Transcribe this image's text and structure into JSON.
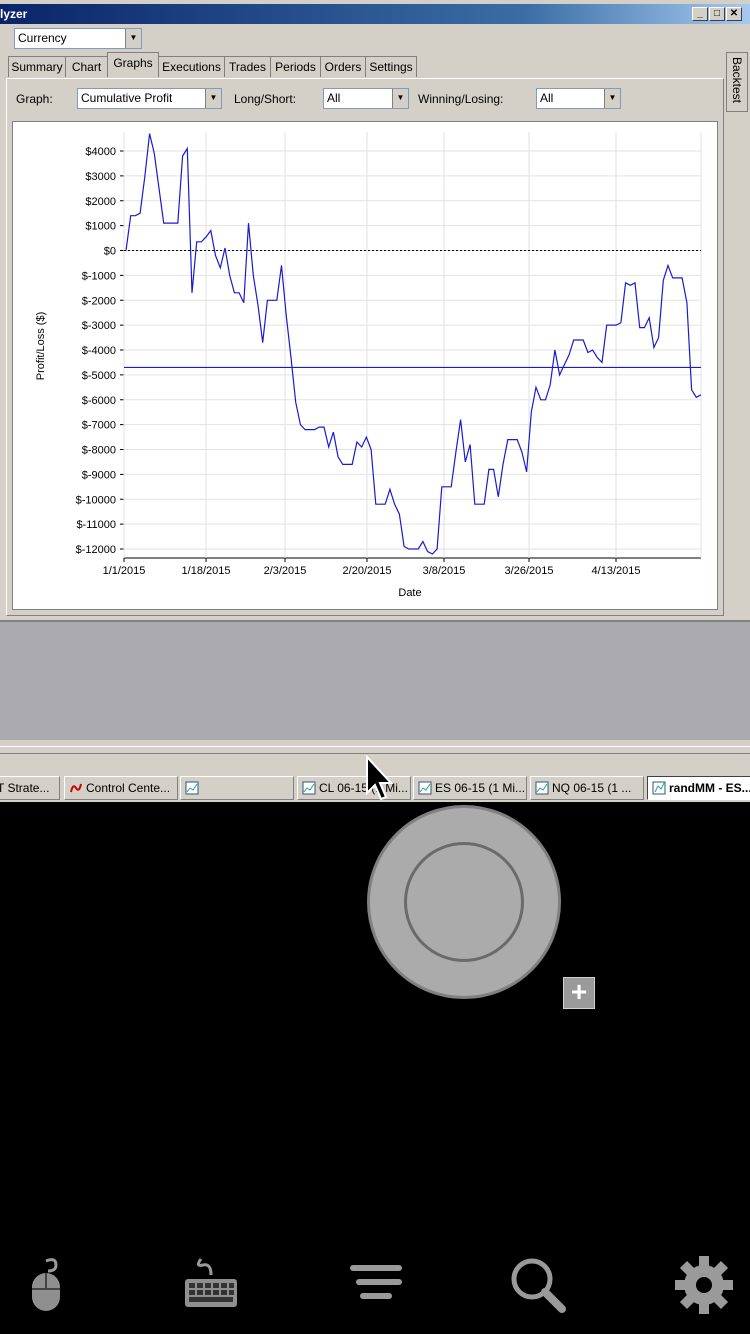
{
  "window": {
    "title": "lyzer",
    "currency_select": "Currency"
  },
  "tabs": [
    "Summary",
    "Chart",
    "Graphs",
    "Executions",
    "Trades",
    "Periods",
    "Orders",
    "Settings"
  ],
  "active_tab": "Graphs",
  "side_tab": "Backtest",
  "filters": {
    "graph_label": "Graph:",
    "graph_value": "Cumulative Profit",
    "longshort_label": "Long/Short:",
    "longshort_value": "All",
    "winlose_label": "Winning/Losing:",
    "winlose_value": "All"
  },
  "chart_data": {
    "type": "line",
    "xlabel": "Date",
    "ylabel": "Profit/Loss ($)",
    "x_ticks": [
      "1/1/2015",
      "1/18/2015",
      "2/3/2015",
      "2/20/2015",
      "3/8/2015",
      "3/26/2015",
      "4/13/2015"
    ],
    "y_ticks": [
      "$4000",
      "$3000",
      "$2000",
      "$1000",
      "$0",
      "$-1000",
      "$-2000",
      "$-3000",
      "$-4000",
      "$-5000",
      "$-6000",
      "$-7000",
      "$-8000",
      "$-9000",
      "$-10000",
      "$-11000",
      "$-12000"
    ],
    "ylim": [
      -12000,
      4000
    ],
    "zero_line": 0,
    "average_line": -4700,
    "series_color": "#1a1ad0",
    "series": [
      {
        "values": [
          0,
          1400,
          1400,
          1500,
          3000,
          4700,
          3900,
          2500,
          1100,
          1100,
          1100,
          1100,
          3800,
          4100,
          -1700,
          350,
          350,
          550,
          800,
          -200,
          -700,
          100,
          -1000,
          -1700,
          -1700,
          -2100,
          1100,
          -1000,
          -2200,
          -3700,
          -2000,
          -2000,
          -2000,
          -600,
          -2600,
          -4300,
          -6100,
          -7000,
          -7200,
          -7200,
          -7200,
          -7100,
          -7100,
          -7900,
          -7300,
          -8300,
          -8600,
          -8600,
          -8600,
          -7700,
          -7900,
          -7500,
          -8000,
          -10200,
          -10200,
          -10200,
          -9600,
          -10200,
          -10600,
          -11900,
          -12000,
          -12000,
          -12000,
          -11700,
          -12100,
          -12200,
          -12000,
          -9500,
          -9500,
          -9500,
          -8100,
          -6800,
          -8500,
          -7800,
          -10200,
          -10200,
          -10200,
          -8800,
          -8800,
          -9900,
          -8600,
          -7600,
          -7600,
          -7600,
          -8100,
          -8900,
          -6500,
          -5500,
          -6000,
          -6000,
          -5400,
          -4000,
          -5000,
          -4600,
          -4200,
          -3600,
          -3600,
          -3600,
          -4100,
          -4000,
          -4300,
          -4500,
          -3000,
          -3000,
          -3000,
          -2900,
          -1300,
          -1400,
          -1300,
          -3100,
          -3100,
          -2700,
          -3900,
          -3500,
          -1200,
          -600,
          -1100,
          -1100,
          -1100,
          -2100,
          -5600,
          -5900,
          -5800
        ]
      }
    ]
  },
  "taskbar": [
    {
      "label": "T Strate...",
      "icon": "strategy-icon"
    },
    {
      "label": "Control Cente...",
      "icon": "ninja-icon"
    },
    {
      "label": "",
      "icon": "chart-icon"
    },
    {
      "label": "CL 06-15 (1 Mi...",
      "icon": "chart-icon"
    },
    {
      "label": "ES 06-15 (1 Mi...",
      "icon": "chart-icon"
    },
    {
      "label": "NQ 06-15 (1 ...",
      "icon": "chart-icon"
    },
    {
      "label": "randMM - ES...",
      "icon": "analyzer-icon"
    }
  ],
  "toolbar_icons": [
    "mouse-icon",
    "keyboard-icon",
    "menu-icon",
    "search-icon",
    "gear-icon"
  ]
}
